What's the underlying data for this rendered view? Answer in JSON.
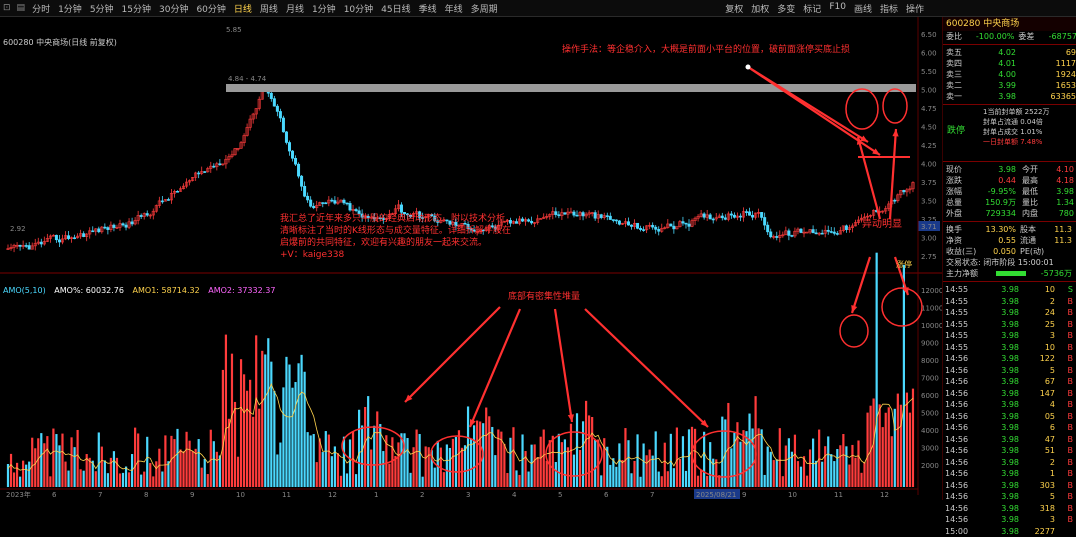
{
  "toolbar": {
    "periods": [
      "分时",
      "1分钟",
      "5分钟",
      "15分钟",
      "30分钟",
      "60分钟",
      "日线",
      "周线",
      "月线",
      "1分钟",
      "10分钟",
      "45日线",
      "季线",
      "年线",
      "多周期"
    ],
    "active_index": 6,
    "right_tools": [
      "复权",
      "加权",
      "多变",
      "标记",
      "F10",
      "画线",
      "指标",
      "操作"
    ]
  },
  "chart": {
    "code_title": "600280 中央商场(日线 前复权)",
    "price_labels": [
      "6.50",
      "6.00",
      "5.50",
      "5.00",
      "4.75",
      "4.50",
      "4.25",
      "4.00",
      "3.75",
      "3.50",
      "3.25",
      "3.00",
      "2.75"
    ],
    "high_mark": "5.85",
    "low_mark": "2.92",
    "band_label": "4.84 - 4.74",
    "current_price_tag": "3.71",
    "volume_legend": {
      "name": "AMO(5,10)",
      "amo": "AMO%: 60032.76",
      "amo1": "AMO1: 58714.32",
      "amo2": "AMO2: 37332.37"
    },
    "volume_axis": [
      "12000",
      "11000",
      "10000",
      "9000",
      "8000",
      "7000",
      "6000",
      "5000",
      "4000",
      "3000",
      "2000"
    ],
    "date_labels": [
      "2023年",
      "6",
      "7",
      "8",
      "9",
      "10",
      "11",
      "12",
      "1",
      "2",
      "3",
      "4",
      "5",
      "6",
      "7",
      "8",
      "9",
      "10",
      "11",
      "12"
    ],
    "selected_date": "2025/08/21",
    "annotations": {
      "tactics": "操作手法：等企稳介入，大概是前面小平台的位置，破前面涨停买底止损",
      "summary_line1": "我汇总了近年来多只牛股的经典启动形态，附以技术分析，",
      "summary_line2": "清晰标注了当时的K线形态与成交量特征。详细拆解牛股在",
      "summary_line3": "启爆前的共同特征，欢迎有兴趣的朋友一起来交流。",
      "contact": "+V：kaige338",
      "abnormal": "异动明显",
      "bottom": "底部有密集性堆量",
      "limit_tag": "涨停"
    }
  },
  "panel": {
    "stock_name": "600280 中央商场",
    "header": [
      {
        "label": "委比",
        "value": "-100.00%",
        "extra": "委差",
        "extra_value": "-68757"
      }
    ],
    "asks": [
      {
        "label": "卖五",
        "price": "4.02",
        "vol": "69"
      },
      {
        "label": "卖四",
        "price": "4.01",
        "vol": "1117"
      },
      {
        "label": "卖三",
        "price": "4.00",
        "vol": "1924"
      },
      {
        "label": "卖二",
        "price": "3.99",
        "vol": "1653"
      },
      {
        "label": "卖一",
        "price": "3.98",
        "vol": "63365"
      }
    ],
    "seal": {
      "tag": "跌停",
      "line1": "1当前封单额 2522万",
      "line2": "封单占流通 0.04倍",
      "line3": "封单占成交 1.01%",
      "line4": "一日封单额 7.48%"
    },
    "quotes": [
      {
        "l": "现价",
        "v": "3.98",
        "l2": "今开",
        "v2": "4.10"
      },
      {
        "l": "涨跌",
        "v": "0.44",
        "l2": "最高",
        "v2": "4.18"
      },
      {
        "l": "涨幅",
        "v": "-9.95%",
        "l2": "最低",
        "v2": "3.98"
      },
      {
        "l": "总量",
        "v": "150.9万",
        "l2": "量比",
        "v2": "1.34"
      },
      {
        "l": "外盘",
        "v": "729334",
        "l2": "内盘",
        "v2": "780"
      }
    ],
    "stats": [
      {
        "l": "换手",
        "v": "13.30%",
        "l2": "股本",
        "v2": "11.3"
      },
      {
        "l": "净资",
        "v": "0.55",
        "l2": "流通",
        "v2": "11.3"
      },
      {
        "l": "收益(三)",
        "v": "0.050",
        "l2": "PE(动)",
        "v2": ""
      }
    ],
    "trade_status": "交易状态: 闭市阶段 15:00:01",
    "main_net": {
      "label": "主力净额",
      "value": "-5736万"
    },
    "ticks": [
      {
        "t": "14:55",
        "p": "3.98",
        "v": "10",
        "s": "S"
      },
      {
        "t": "14:55",
        "p": "3.98",
        "v": "2",
        "s": "B"
      },
      {
        "t": "14:55",
        "p": "3.98",
        "v": "24",
        "s": "B"
      },
      {
        "t": "14:55",
        "p": "3.98",
        "v": "25",
        "s": "B"
      },
      {
        "t": "14:55",
        "p": "3.98",
        "v": "3",
        "s": "B"
      },
      {
        "t": "14:55",
        "p": "3.98",
        "v": "10",
        "s": "B"
      },
      {
        "t": "14:56",
        "p": "3.98",
        "v": "122",
        "s": "B"
      },
      {
        "t": "14:56",
        "p": "3.98",
        "v": "5",
        "s": "B"
      },
      {
        "t": "14:56",
        "p": "3.98",
        "v": "67",
        "s": "B"
      },
      {
        "t": "14:56",
        "p": "3.98",
        "v": "147",
        "s": "B"
      },
      {
        "t": "14:56",
        "p": "3.98",
        "v": "4",
        "s": "B"
      },
      {
        "t": "14:56",
        "p": "3.98",
        "v": "05",
        "s": "B"
      },
      {
        "t": "14:56",
        "p": "3.98",
        "v": "6",
        "s": "B"
      },
      {
        "t": "14:56",
        "p": "3.98",
        "v": "47",
        "s": "B"
      },
      {
        "t": "14:56",
        "p": "3.98",
        "v": "51",
        "s": "B"
      },
      {
        "t": "14:56",
        "p": "3.98",
        "v": "2",
        "s": "B"
      },
      {
        "t": "14:56",
        "p": "3.98",
        "v": "1",
        "s": "B"
      },
      {
        "t": "14:56",
        "p": "3.98",
        "v": "303",
        "s": "B"
      },
      {
        "t": "14:56",
        "p": "3.98",
        "v": "5",
        "s": "B"
      },
      {
        "t": "14:56",
        "p": "3.98",
        "v": "318",
        "s": "B"
      },
      {
        "t": "14:56",
        "p": "3.98",
        "v": "3",
        "s": "B"
      },
      {
        "t": "15:00",
        "p": "3.98",
        "v": "2277",
        "s": ""
      }
    ]
  },
  "colors": {
    "up": "#ff3c3c",
    "down": "#4bd9ff",
    "ma": "#ffd34d",
    "annotation": "#ff3030"
  }
}
